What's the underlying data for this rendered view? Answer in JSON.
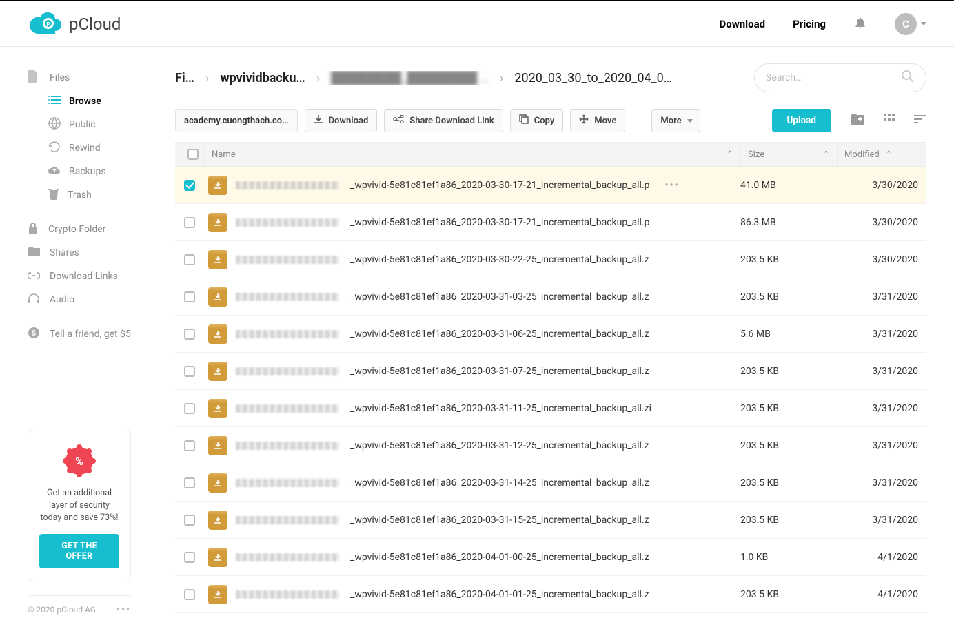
{
  "header": {
    "brand": "pCloud",
    "download": "Download",
    "pricing": "Pricing",
    "avatar_initial": "C"
  },
  "sidebar": {
    "files": "Files",
    "browse": "Browse",
    "public": "Public",
    "rewind": "Rewind",
    "backups": "Backups",
    "trash": "Trash",
    "crypto": "Crypto Folder",
    "shares": "Shares",
    "dlinks": "Download Links",
    "audio": "Audio",
    "tell": "Tell a friend, get $5"
  },
  "promo": {
    "line": "Get an additional layer of security today and save 73%!",
    "cta": "GET THE OFFER"
  },
  "footer": {
    "copyright": "© 2020 pCloud AG"
  },
  "breadcrumbs": {
    "b1": "Fi…",
    "b2": "wpvividbacku…",
    "b3_blur": "████████_████████ …",
    "b4": "2020_03_30_to_2020_04_0…"
  },
  "search": {
    "placeholder": "Search..."
  },
  "toolbar": {
    "path": "academy.cuongthach.co…",
    "download": "Download",
    "share": "Share Download Link",
    "copy": "Copy",
    "move": "Move",
    "more": "More",
    "upload": "Upload"
  },
  "columns": {
    "name": "Name",
    "size": "Size",
    "modified": "Modified"
  },
  "rows": [
    {
      "selected": true,
      "name": "_wpvivid-5e81c81ef1a86_2020-03-30-17-21_incremental_backup_all.p",
      "size": "41.0 MB",
      "modified": "3/30/2020"
    },
    {
      "selected": false,
      "name": "_wpvivid-5e81c81ef1a86_2020-03-30-17-21_incremental_backup_all.p",
      "size": "86.3 MB",
      "modified": "3/30/2020"
    },
    {
      "selected": false,
      "name": "_wpvivid-5e81c81ef1a86_2020-03-30-22-25_incremental_backup_all.z",
      "size": "203.5 KB",
      "modified": "3/30/2020"
    },
    {
      "selected": false,
      "name": "_wpvivid-5e81c81ef1a86_2020-03-31-03-25_incremental_backup_all.z",
      "size": "203.5 KB",
      "modified": "3/31/2020"
    },
    {
      "selected": false,
      "name": "_wpvivid-5e81c81ef1a86_2020-03-31-06-25_incremental_backup_all.z",
      "size": "5.6 MB",
      "modified": "3/31/2020"
    },
    {
      "selected": false,
      "name": "_wpvivid-5e81c81ef1a86_2020-03-31-07-25_incremental_backup_all.z",
      "size": "203.5 KB",
      "modified": "3/31/2020"
    },
    {
      "selected": false,
      "name": "_wpvivid-5e81c81ef1a86_2020-03-31-11-25_incremental_backup_all.zi",
      "size": "203.5 KB",
      "modified": "3/31/2020"
    },
    {
      "selected": false,
      "name": "_wpvivid-5e81c81ef1a86_2020-03-31-12-25_incremental_backup_all.z",
      "size": "203.5 KB",
      "modified": "3/31/2020"
    },
    {
      "selected": false,
      "name": "_wpvivid-5e81c81ef1a86_2020-03-31-14-25_incremental_backup_all.z",
      "size": "203.5 KB",
      "modified": "3/31/2020"
    },
    {
      "selected": false,
      "name": "_wpvivid-5e81c81ef1a86_2020-03-31-15-25_incremental_backup_all.z",
      "size": "203.5 KB",
      "modified": "3/31/2020"
    },
    {
      "selected": false,
      "name": "_wpvivid-5e81c81ef1a86_2020-04-01-00-25_incremental_backup_all.z",
      "size": "1.0 KB",
      "modified": "4/1/2020"
    },
    {
      "selected": false,
      "name": "_wpvivid-5e81c81ef1a86_2020-04-01-01-25_incremental_backup_all.z",
      "size": "203.5 KB",
      "modified": "4/1/2020"
    }
  ]
}
